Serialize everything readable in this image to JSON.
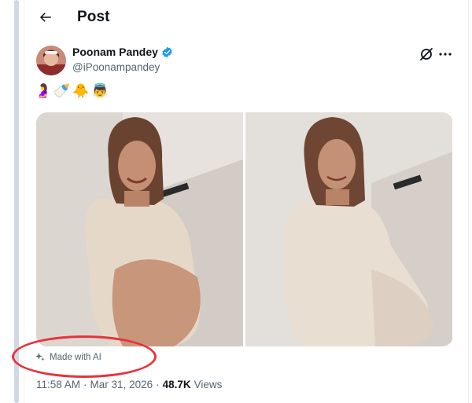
{
  "header": {
    "title": "Post"
  },
  "post": {
    "author": {
      "name": "Poonam Pandey",
      "handle": "@iPoonampandey",
      "verified": true
    },
    "text_emojis": [
      "🤰",
      "🍼",
      "🐥",
      "👼"
    ],
    "media_count": 2,
    "ai_label": "Made with AI",
    "meta": {
      "time": "11:58 AM",
      "separator": "·",
      "date": "Mar 31, 2026",
      "views_count": "48.7K",
      "views_label": "Views"
    }
  },
  "annotation": {
    "color": "#e8323b"
  },
  "colors": {
    "verified": "#1d9bf0",
    "muted_text": "#536471"
  }
}
